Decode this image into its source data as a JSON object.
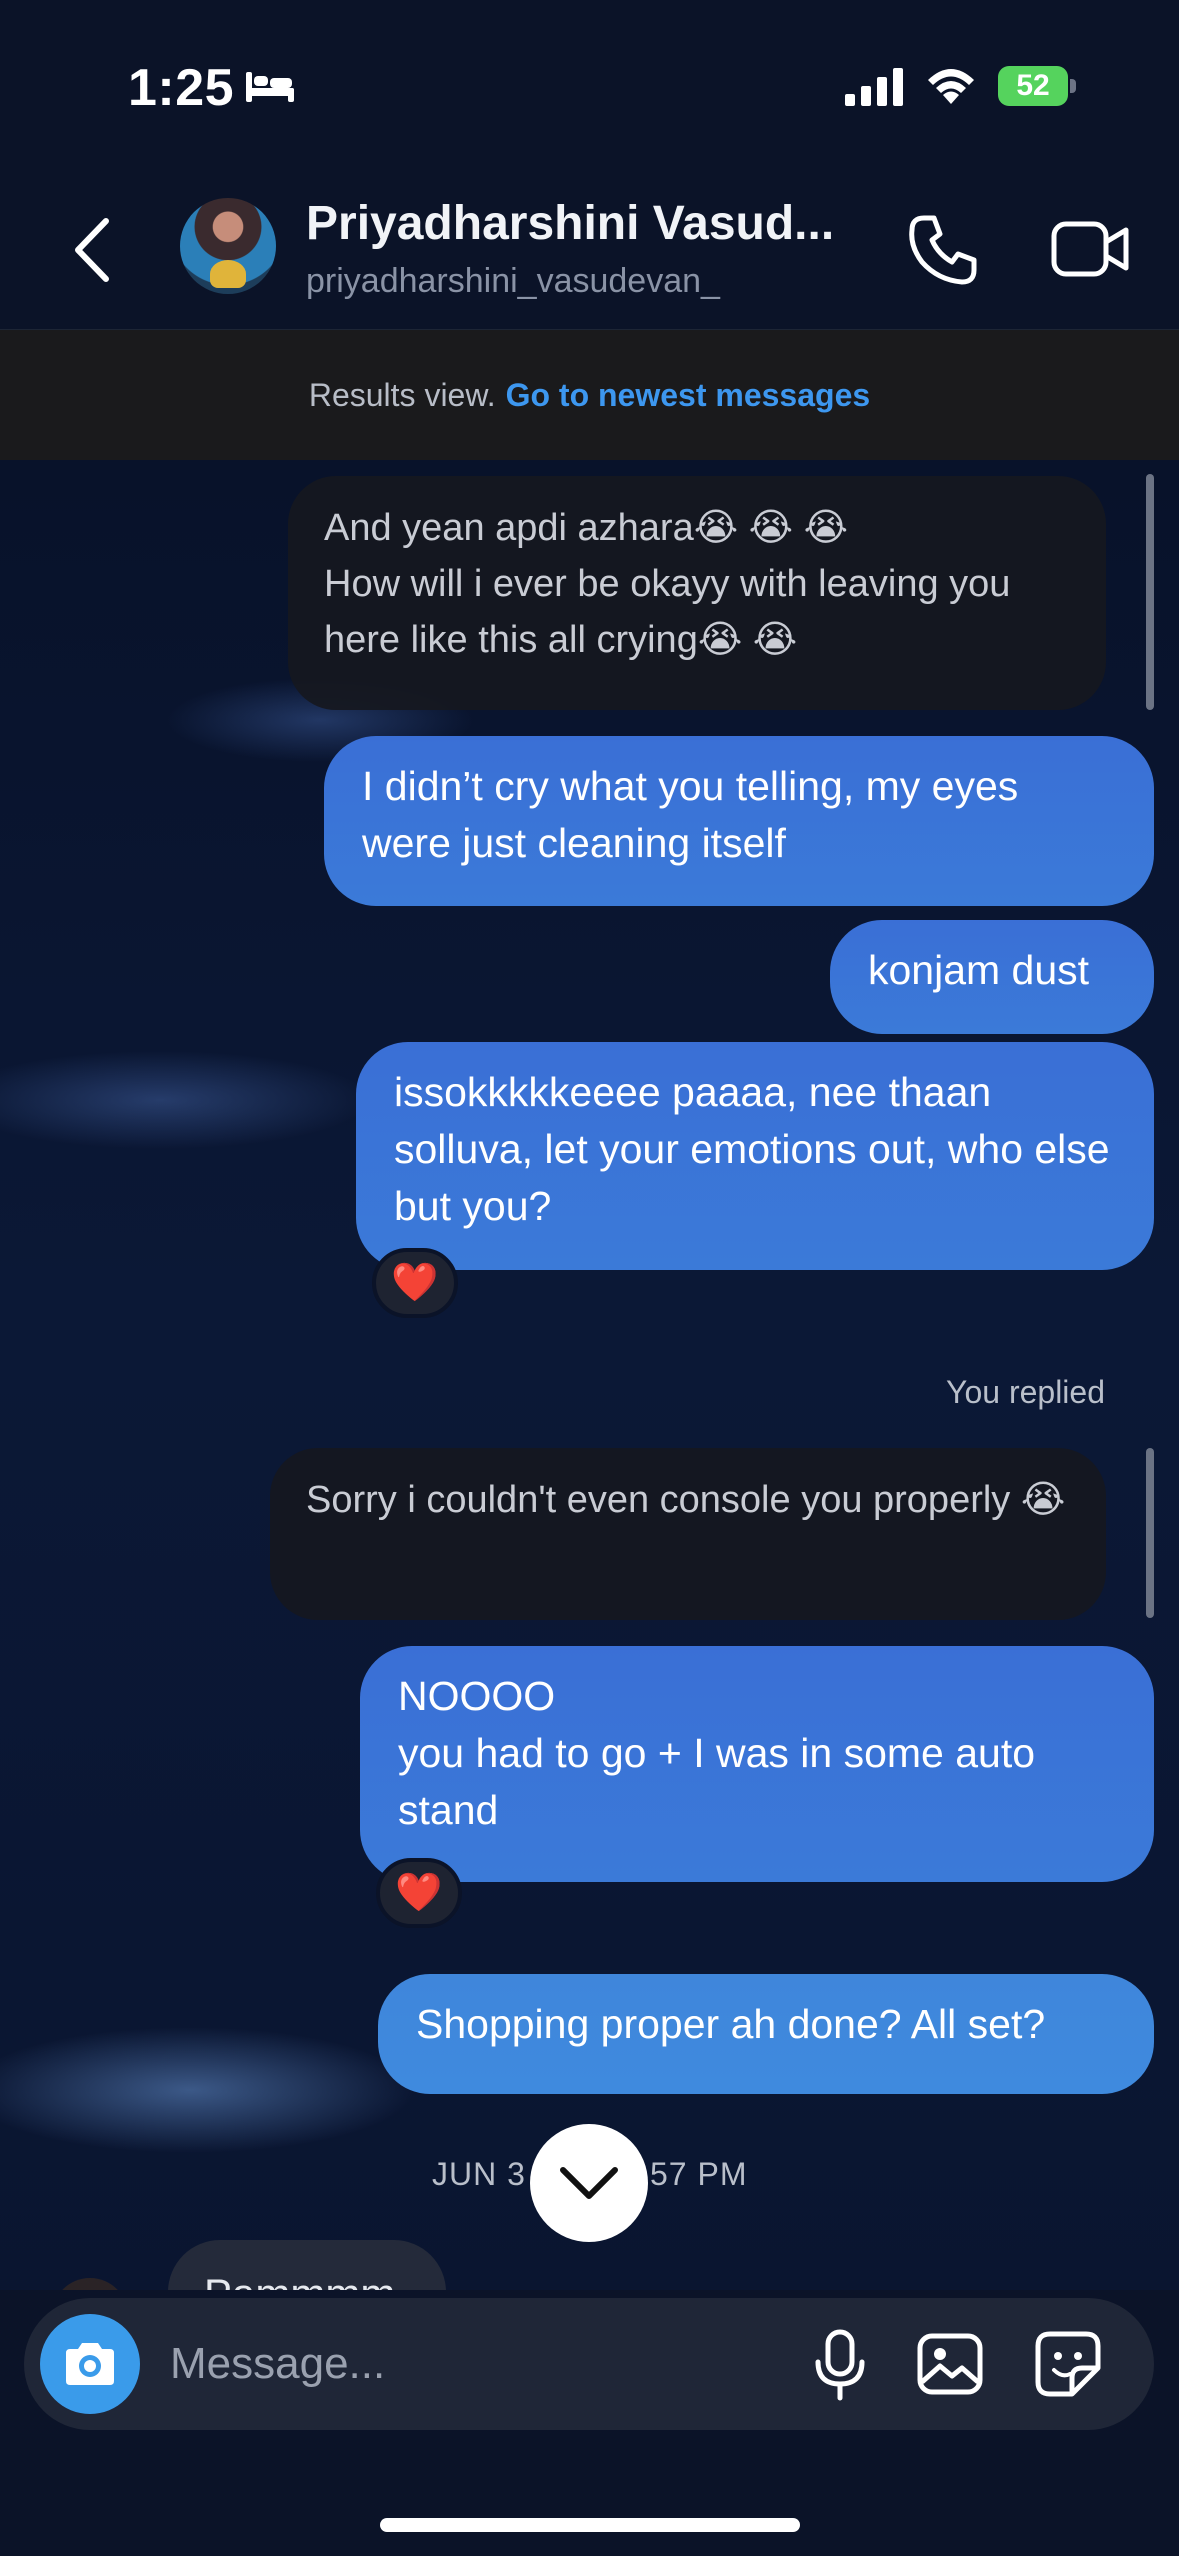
{
  "status_bar": {
    "time": "1:25",
    "battery_level": "52",
    "focus_icon": "bed-icon"
  },
  "header": {
    "contact_name": "Priyadharshini Vasud...",
    "username": "priyadharshini_vasudevan_"
  },
  "results_banner": {
    "label": "Results view.",
    "link": "Go to newest messages"
  },
  "messages": [
    {
      "side": "in",
      "text": "And yean apdi azhara😭 😭 😭\nHow will i ever be okayy with leaving you here like this all crying😭 😭"
    },
    {
      "side": "out",
      "text": "I didn’t cry what you telling, my eyes were just cleaning itself"
    },
    {
      "side": "out",
      "text": "konjam dust"
    },
    {
      "side": "out",
      "text": "issokkkkkeeee paaaa, nee thaan solluva, let your emotions out, who else but you?",
      "reaction": "❤️"
    },
    {
      "side": "in",
      "text": "Sorry i couldn't even console you properly 😭"
    },
    {
      "side": "out",
      "text": "NOOOO\nyou had to go + I was in some auto stand",
      "reaction": "❤️"
    },
    {
      "side": "out",
      "text": "Shopping proper ah done? All set?"
    },
    {
      "side": "in",
      "text": "Pammmm"
    }
  ],
  "reply_label": "You replied",
  "date_separator_left": "JUN 3",
  "date_separator_right": "57 PM",
  "composer": {
    "placeholder": "Message..."
  },
  "colors": {
    "background": "#0b1328",
    "outgoing_bubble": "#3a6fd6",
    "incoming_bubble": "#16181f",
    "link": "#3d97ef",
    "battery": "#55d35d"
  }
}
